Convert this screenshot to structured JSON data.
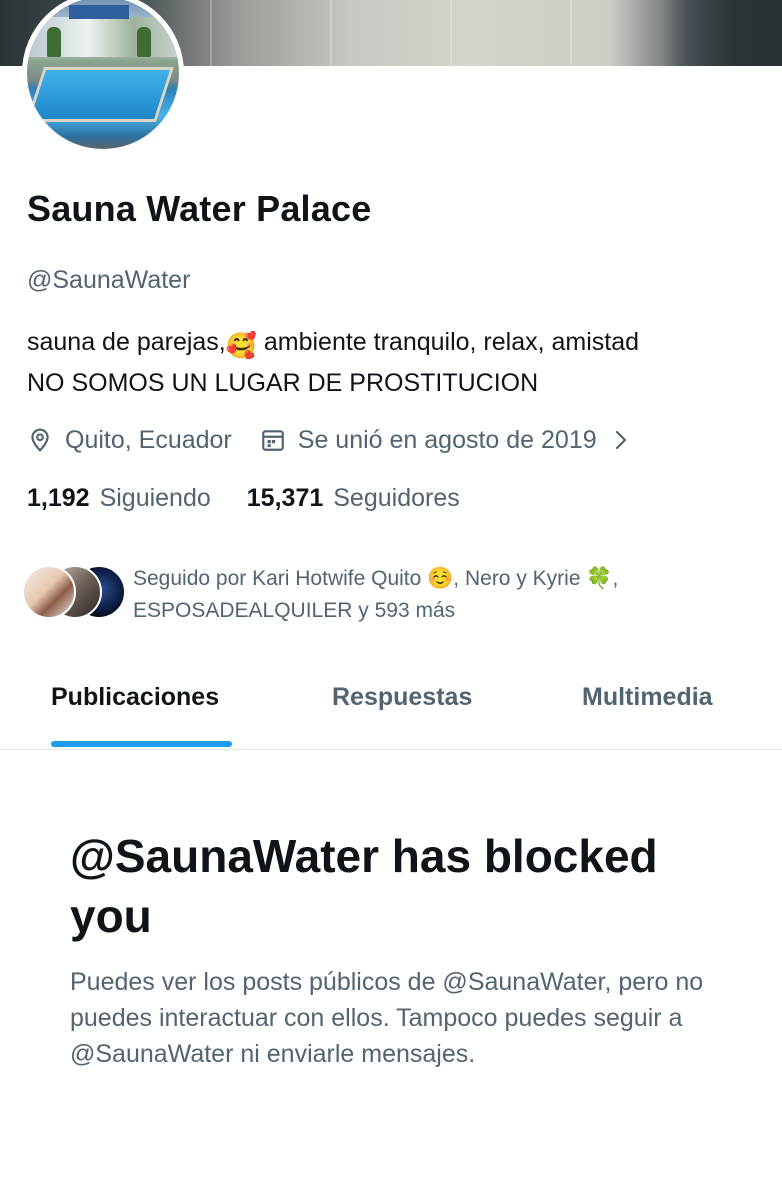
{
  "profile": {
    "display_name": "Sauna Water Palace",
    "handle": "@SaunaWater",
    "bio_line1_a": "sauna de parejas,",
    "bio_emoji": "🥰",
    "bio_line1_b": " ambiente tranquilo, relax, amistad",
    "bio_line2": "NO SOMOS UN LUGAR DE PROSTITUCION",
    "location": "Quito, Ecuador",
    "joined": "Se unió en agosto de 2019",
    "following_count": "1,192",
    "following_label": "Siguiendo",
    "followers_count": "15,371",
    "followers_label": "Seguidores"
  },
  "mutuals": {
    "line1": "Seguido por Kari Hotwife Quito ☺️, Nero y Kyrie 🍀,",
    "line2": "ESPOSADEALQUILER y 593 más"
  },
  "tabs": [
    {
      "label": "Publicaciones",
      "active": true
    },
    {
      "label": "Respuestas",
      "active": false
    },
    {
      "label": "Multimedia",
      "active": false
    }
  ],
  "blocked": {
    "title": "@SaunaWater has blocked you",
    "description": "Puedes ver los posts públicos de @SaunaWater, pero no puedes interactuar con ellos. Tampoco puedes seguir a @SaunaWater ni enviarle mensajes."
  },
  "icons": {
    "location": "location-pin-icon",
    "calendar": "calendar-icon",
    "chevron": "chevron-right-icon"
  },
  "colors": {
    "accent": "#1d9bf0",
    "text_primary": "#0f1419",
    "text_secondary": "#536471"
  }
}
